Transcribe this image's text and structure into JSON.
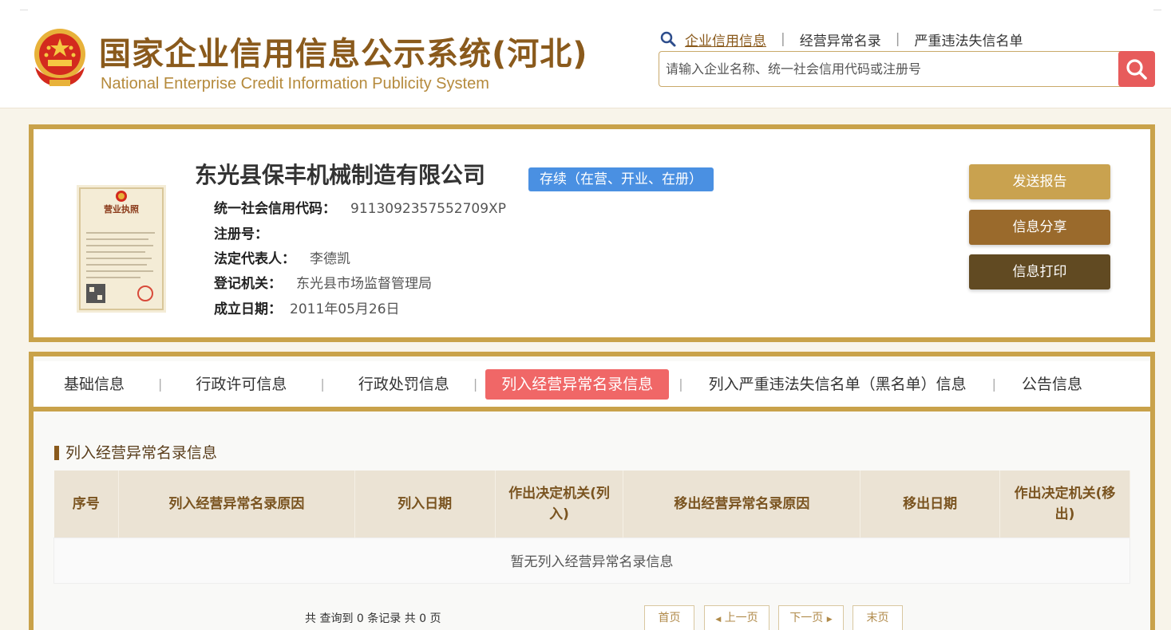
{
  "header": {
    "title_cn": "国家企业信用信息公示系统(河北)",
    "title_en": "National Enterprise Credit Information Publicity System",
    "nav": [
      {
        "label": "企业信用信息",
        "active": true
      },
      {
        "label": "经营异常名录",
        "active": false
      },
      {
        "label": "严重违法失信名单",
        "active": false
      }
    ],
    "search_placeholder": "请输入企业名称、统一社会信用代码或注册号"
  },
  "company": {
    "name": "东光县保丰机械制造有限公司",
    "status": "存续（在营、开业、在册）",
    "license_title": "营业执照",
    "fields": [
      {
        "label": "统一社会信用代码：",
        "value": "9113092357552709XP"
      },
      {
        "label": "注册号：",
        "value": ""
      },
      {
        "label": "法定代表人：",
        "value": "李德凯"
      },
      {
        "label": "登记机关：",
        "value": "东光县市场监督管理局"
      },
      {
        "label": "成立日期：",
        "value": "2011年05月26日"
      }
    ],
    "actions": [
      {
        "label": "发送报告",
        "color": "#c9a24f"
      },
      {
        "label": "信息分享",
        "color": "#9a6a2c"
      },
      {
        "label": "信息打印",
        "color": "#614a22"
      }
    ]
  },
  "tabs": [
    {
      "label": "基础信息",
      "active": false
    },
    {
      "label": "行政许可信息",
      "active": false
    },
    {
      "label": "行政处罚信息",
      "active": false
    },
    {
      "label": "列入经营异常名录信息",
      "active": true
    },
    {
      "label": "列入严重违法失信名单（黑名单）信息",
      "active": false
    },
    {
      "label": "公告信息",
      "active": false
    }
  ],
  "section": {
    "title": "列入经营异常名录信息",
    "columns": [
      "序号",
      "列入经营异常名录原因",
      "列入日期",
      "作出决定机关(列入)",
      "移出经营异常名录原因",
      "移出日期",
      "作出决定机关(移出)"
    ],
    "empty_text": "暂无列入经营异常名录信息"
  },
  "pagination": {
    "info": "共 查询到 0 条记录 共 0 页",
    "first": "首页",
    "prev": "上一页",
    "next": "下一页",
    "last": "末页"
  },
  "colors": {
    "brand_gold": "#c9a24a",
    "brand_brown": "#8a5a1c",
    "active_tab": "#f06767",
    "status_blue": "#4a90e2",
    "search_red": "#e75b5b"
  }
}
